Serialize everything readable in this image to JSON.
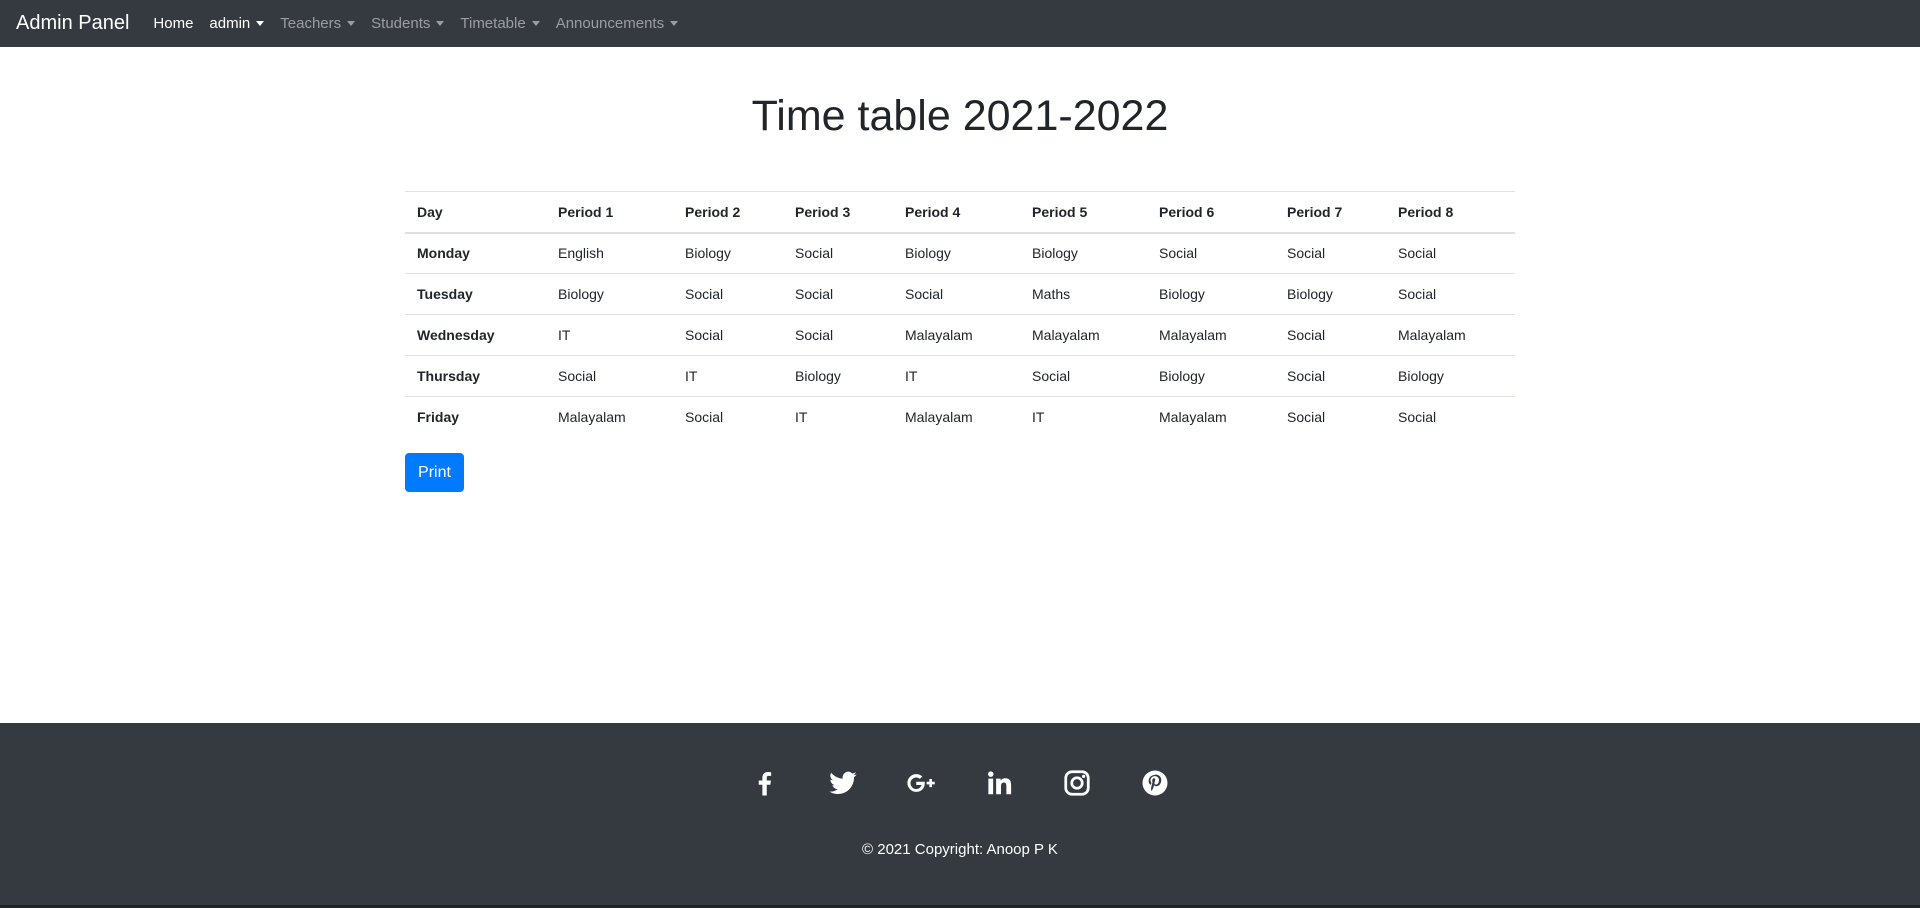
{
  "navbar": {
    "brand": "Admin Panel",
    "items": [
      {
        "label": "Home"
      },
      {
        "label": "admin"
      },
      {
        "label": "Teachers"
      },
      {
        "label": "Students"
      },
      {
        "label": "Timetable"
      },
      {
        "label": "Announcements"
      }
    ]
  },
  "page": {
    "title": "Time table 2021-2022"
  },
  "timetable": {
    "headers": [
      "Day",
      "Period 1",
      "Period 2",
      "Period 3",
      "Period 4",
      "Period 5",
      "Period 6",
      "Period 7",
      "Period 8"
    ],
    "rows": [
      {
        "day": "Monday",
        "periods": [
          "English",
          "Biology",
          "Social",
          "Biology",
          "Biology",
          "Social",
          "Social",
          "Social"
        ]
      },
      {
        "day": "Tuesday",
        "periods": [
          "Biology",
          "Social",
          "Social",
          "Social",
          "Maths",
          "Biology",
          "Biology",
          "Social"
        ]
      },
      {
        "day": "Wednesday",
        "periods": [
          "IT",
          "Social",
          "Social",
          "Malayalam",
          "Malayalam",
          "Malayalam",
          "Social",
          "Malayalam"
        ]
      },
      {
        "day": "Thursday",
        "periods": [
          "Social",
          "IT",
          "Biology",
          "IT",
          "Social",
          "Biology",
          "Social",
          "Biology"
        ]
      },
      {
        "day": "Friday",
        "periods": [
          "Malayalam",
          "Social",
          "IT",
          "Malayalam",
          "IT",
          "Malayalam",
          "Social",
          "Social"
        ]
      }
    ]
  },
  "actions": {
    "print_label": "Print"
  },
  "footer": {
    "social_icons": [
      "facebook-icon",
      "twitter-icon",
      "google-plus-icon",
      "linkedin-icon",
      "instagram-icon",
      "pinterest-icon"
    ],
    "copyright": "© 2021 Copyright: Anoop P K"
  },
  "colors": {
    "navbar": "#343a40",
    "primary": "#007bff",
    "footer": "#343a40"
  }
}
